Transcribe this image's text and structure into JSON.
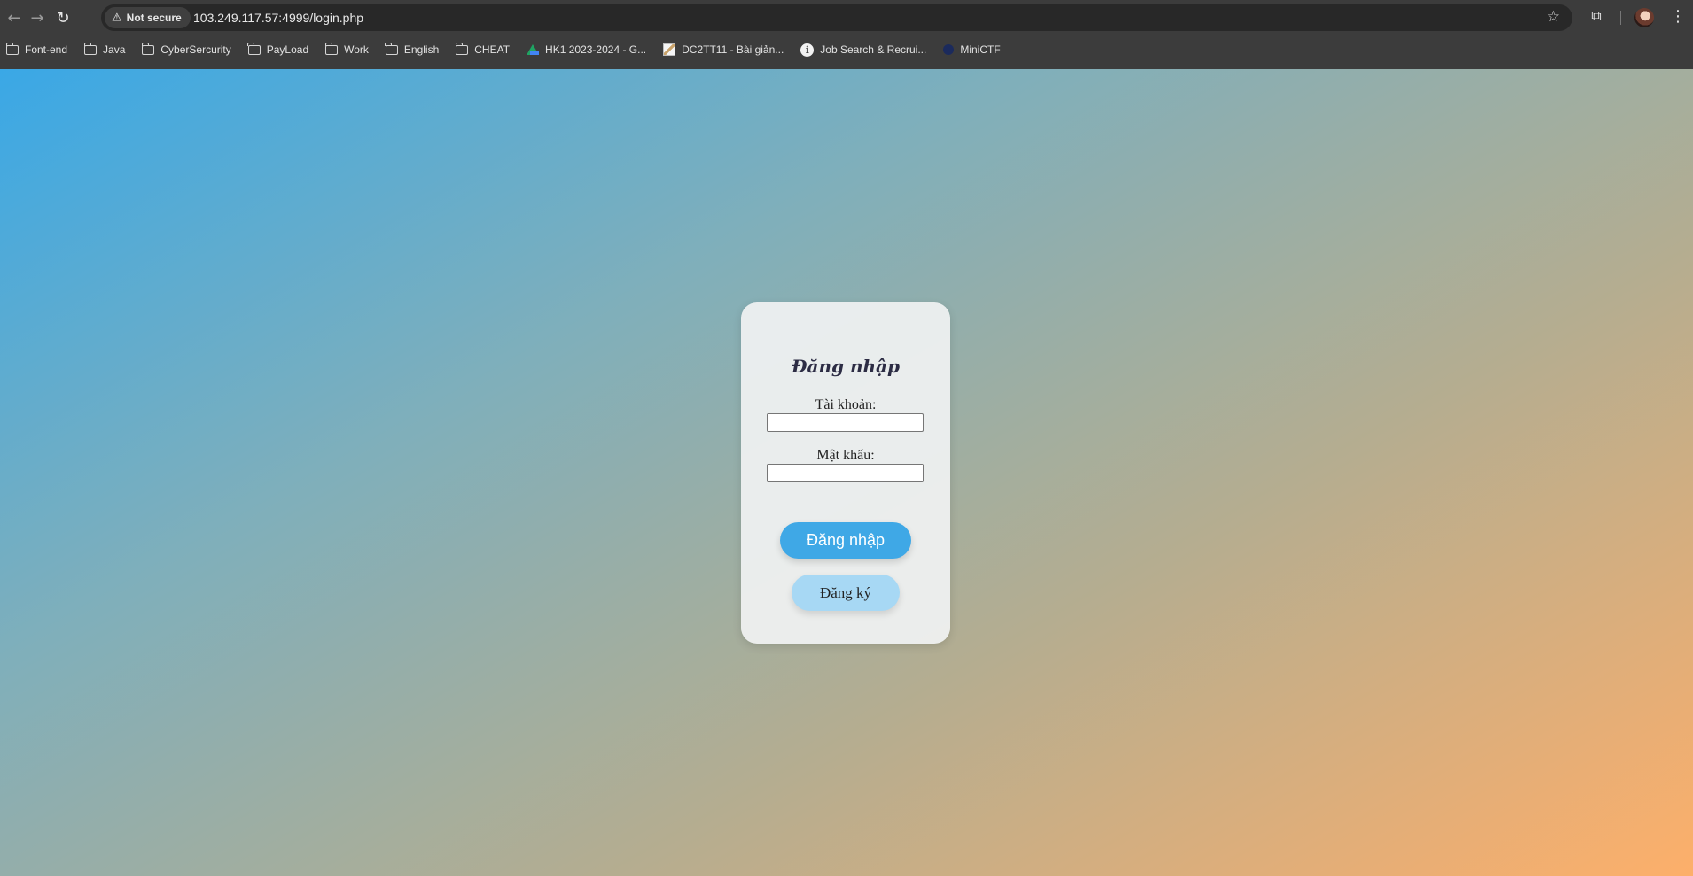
{
  "browser": {
    "back_icon": "back-arrow-icon",
    "forward_icon": "forward-arrow-icon",
    "reload_icon": "reload-icon",
    "security_label": "Not secure",
    "url": "103.249.117.57:4999/login.php",
    "bookmarks": [
      {
        "label": "Font-end",
        "icon": "folder-icon"
      },
      {
        "label": "Java",
        "icon": "folder-icon"
      },
      {
        "label": "CyberSercurity",
        "icon": "folder-icon"
      },
      {
        "label": "PayLoad",
        "icon": "folder-icon"
      },
      {
        "label": "Work",
        "icon": "folder-icon"
      },
      {
        "label": "English",
        "icon": "folder-icon"
      },
      {
        "label": "CHEAT",
        "icon": "folder-icon"
      },
      {
        "label": "HK1 2023-2024 - G...",
        "icon": "google-drive-icon"
      },
      {
        "label": "DC2TT11 - Bài giản...",
        "icon": "document-icon"
      },
      {
        "label": "Job Search & Recrui...",
        "icon": "info-icon"
      },
      {
        "label": "MiniCTF",
        "icon": "ctf-icon"
      }
    ]
  },
  "login": {
    "title": "Đăng nhập",
    "username_label": "Tài khoản:",
    "username_value": "",
    "password_label": "Mật khẩu:",
    "password_value": "",
    "submit_label": "Đăng nhập",
    "register_label": "Đăng ký"
  },
  "colors": {
    "gradient_start": "#3aa8e6",
    "gradient_end": "#fdaf6a",
    "login_button": "#3fa8e6",
    "register_button": "#a7d8f4"
  }
}
